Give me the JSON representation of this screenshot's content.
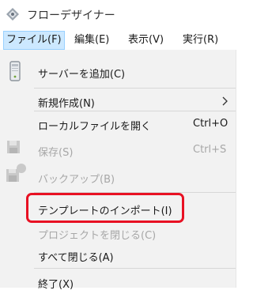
{
  "window": {
    "title": "フローデザイナー"
  },
  "menubar": {
    "items": [
      {
        "label": "ファイル(F)"
      },
      {
        "label": "編集(E)"
      },
      {
        "label": "表示(V)"
      },
      {
        "label": "実行(R)"
      }
    ]
  },
  "file_menu": {
    "items": [
      {
        "label": "サーバーを追加(C)",
        "shortcut": "",
        "enabled": true
      },
      {
        "label": "新規作成(N)",
        "shortcut": "",
        "enabled": true,
        "submenu_arrow": ">"
      },
      {
        "label": "ローカルファイルを開く",
        "shortcut": "Ctrl+O",
        "enabled": true
      },
      {
        "label": "保存(S)",
        "shortcut": "Ctrl+S",
        "enabled": false
      },
      {
        "label": "バックアップ(B)",
        "shortcut": "",
        "enabled": false
      },
      {
        "label": "テンプレートのインポート(I)",
        "shortcut": "",
        "enabled": true,
        "highlighted": true
      },
      {
        "label": "プロジェクトを閉じる(C)",
        "shortcut": "",
        "enabled": false
      },
      {
        "label": "すべて閉じる(A)",
        "shortcut": "",
        "enabled": true
      },
      {
        "label": "終了(X)",
        "shortcut": "",
        "enabled": true
      }
    ]
  },
  "colors": {
    "menu_active_bg": "#cce8ff",
    "dropdown_bg": "#f2f2f2",
    "disabled_text": "#a7a7a7",
    "highlight_border": "#e81123"
  }
}
